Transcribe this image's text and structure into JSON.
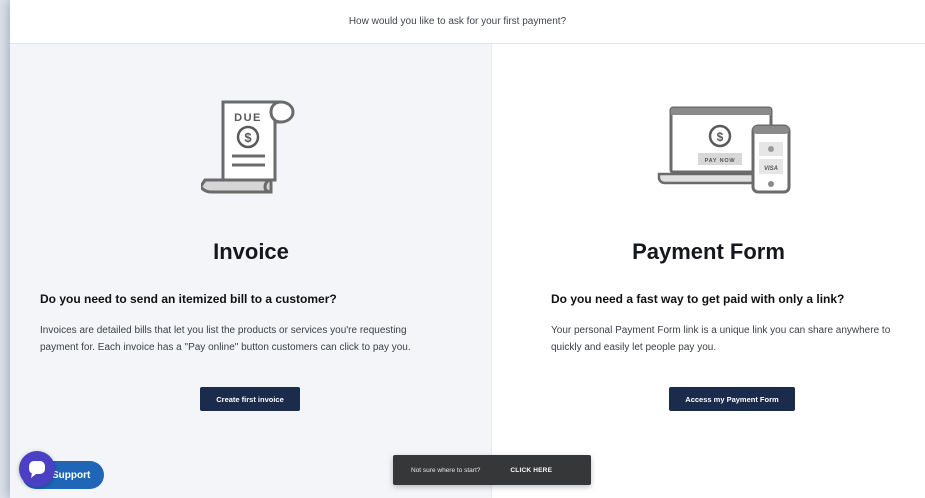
{
  "header": {
    "prompt": "How would you like to ask for your first payment?"
  },
  "invoice": {
    "icon_due_text": "DUE",
    "title": "Invoice",
    "question": "Do you need to send an itemized bill to a customer?",
    "description": "Invoices are detailed bills that let you list the products or services you're requesting payment for. Each invoice has a \"Pay online\" button customers can click to pay you.",
    "button_label": "Create first invoice"
  },
  "payment_form": {
    "icon_pay_now_text": "PAY NOW",
    "icon_card_text": "VISA",
    "title": "Payment Form",
    "question": "Do you need a fast way to get paid with only a link?",
    "description": "Your personal Payment Form link is a unique link you can share anywhere to quickly and easily let people pay you.",
    "button_label": "Access my Payment Form"
  },
  "help_bar": {
    "question": "Not sure where to start?",
    "cta": "CLICK HERE"
  },
  "support": {
    "label": "Support"
  },
  "colors": {
    "button_bg": "#1a2b4b",
    "left_panel_bg": "#f3f5f8",
    "support_blue": "#1f66b8",
    "chat_bubble": "#4b3fc4",
    "help_bar_bg": "#353739"
  }
}
